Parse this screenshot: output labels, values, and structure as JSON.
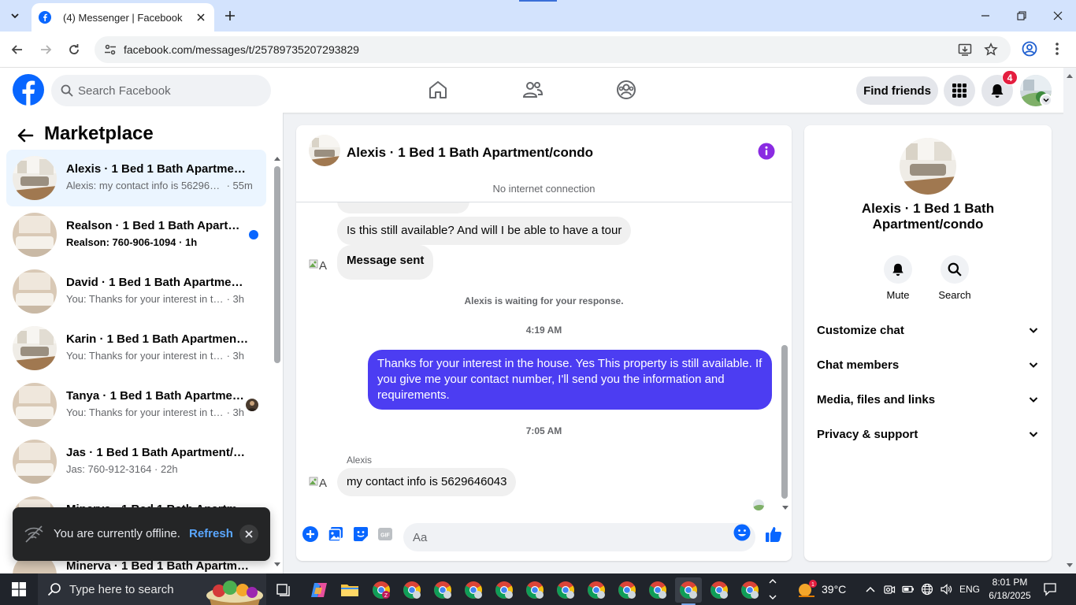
{
  "browser": {
    "tab_title": "(4) Messenger | Facebook",
    "url": "facebook.com/messages/t/25789735207293829"
  },
  "header": {
    "search_placeholder": "Search Facebook",
    "find_friends": "Find friends",
    "notification_count": "4",
    "brand_color": "#0866ff"
  },
  "sidebar": {
    "title": "Marketplace",
    "conversations": [
      {
        "name": "Alexis · 1 Bed 1 Bath Apartment/condo",
        "preview": "Alexis: my contact info is 5629646043",
        "time": " · 55m",
        "unread": false,
        "active": true
      },
      {
        "name": "Realson · 1 Bed 1 Bath Apartment/condo",
        "preview": "Realson: 760-906-1094",
        "time": " · 1h",
        "unread": true,
        "active": false
      },
      {
        "name": "David · 1 Bed 1 Bath Apartment/condo",
        "preview": "You: Thanks for your interest in the house.",
        "time": " · 3h",
        "unread": false,
        "active": false
      },
      {
        "name": "Karin · 1 Bed 1 Bath Apartment/condo",
        "preview": "You: Thanks for your interest in the house.",
        "time": " · 3h",
        "unread": false,
        "active": false
      },
      {
        "name": "Tanya · 1 Bed 1 Bath Apartment/condo",
        "preview": "You: Thanks for your interest in the house.",
        "time": " · 3h",
        "unread": false,
        "active": false
      },
      {
        "name": "Jas · 1 Bed 1 Bath Apartment/condo",
        "preview": "Jas: 760-912-3164",
        "time": " · 22h",
        "unread": false,
        "active": false
      },
      {
        "name": "Minerva · 1 Bed 1 Bath Apartment/condo",
        "preview": "",
        "time": "",
        "unread": false,
        "active": false
      },
      {
        "name": "Minerva · 1 Bed 1 Bath Apartment/condo",
        "preview": "",
        "time": "",
        "unread": false,
        "active": false
      }
    ]
  },
  "toast": {
    "text": "You are currently offline.",
    "action": "Refresh"
  },
  "chat": {
    "title": "Alexis · 1 Bed 1 Bath Apartment/condo",
    "connection_status": "No internet connection",
    "messages": {
      "m1": "Is this still available? And will I be able to have a tour",
      "m2": "Message sent",
      "waiting": "Alexis is waiting for your response.",
      "time1": "4:19 AM",
      "m3": "Thanks for your interest in the house. Yes This property is still available. If you give me your contact number, I'll send you the information and requirements.",
      "time2": "7:05 AM",
      "sender": "Alexis",
      "m4": "my contact info is 5629646043",
      "avatar_alt": "A"
    },
    "composer_placeholder": "Aa",
    "outgoing_color": "#4c3df2"
  },
  "info": {
    "name": "Alexis · 1 Bed 1 Bath Apartment/condo",
    "mute": "Mute",
    "search": "Search",
    "sections": [
      "Customize chat",
      "Chat members",
      "Media, files and links",
      "Privacy & support"
    ],
    "accent_color": "#8a2be2"
  },
  "taskbar": {
    "search_placeholder": "Type here to search",
    "temperature": "39°C",
    "language": "ENG",
    "time": "8:01 PM",
    "date": "6/18/2025"
  }
}
